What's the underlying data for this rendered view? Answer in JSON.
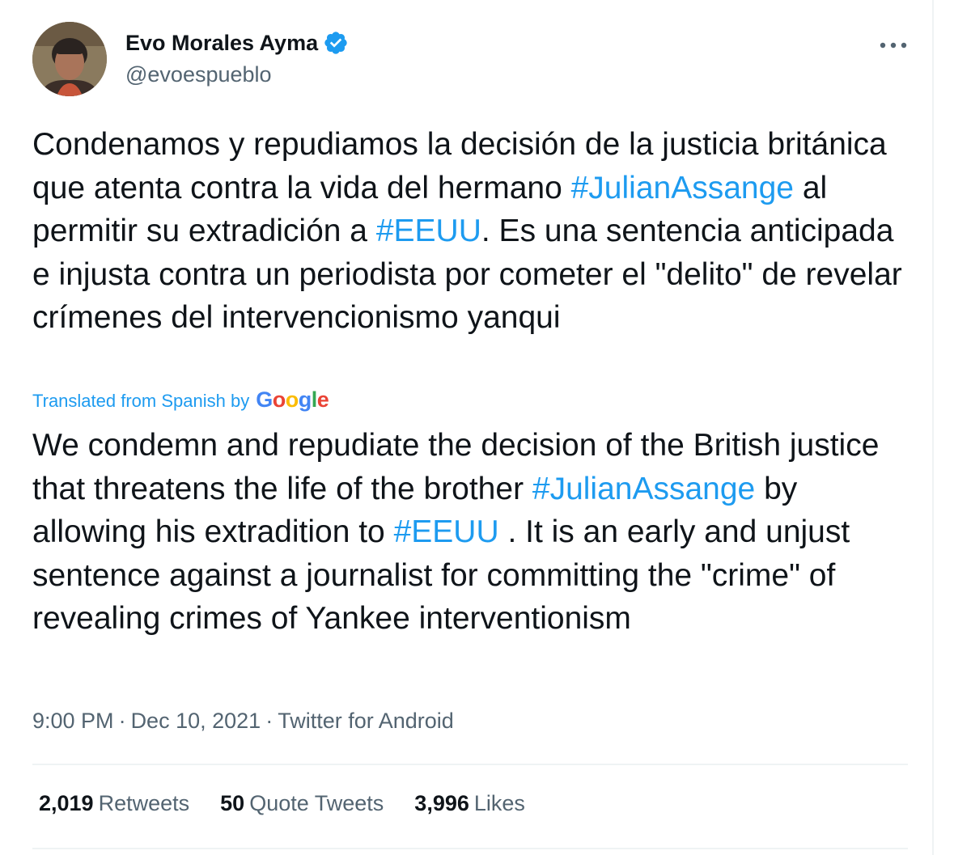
{
  "author": {
    "name": "Evo Morales Ayma",
    "handle": "@evoespueblo",
    "verified": true
  },
  "original_text": {
    "part1": "Condenamos y repudiamos la decisión de la justicia británica que atenta contra la vida del hermano ",
    "hashtag1": "#JulianAssange",
    "part2": " al permitir su extradición a ",
    "hashtag2": "#EEUU",
    "part3": ". Es una sentencia anticipada e injusta contra un periodista por cometer el \"delito\" de revelar crímenes del intervencionismo yanqui"
  },
  "translation": {
    "note": "Translated from Spanish by",
    "provider": "Google",
    "part1": "We condemn and repudiate the decision of the British justice that threatens the life of the brother ",
    "hashtag1": "#JulianAssange",
    "part2": " by allowing his extradition to ",
    "hashtag2": "#EEUU",
    "part3": " . It is an early and unjust sentence against a journalist for committing the \"crime\" of revealing crimes of Yankee interventionism"
  },
  "meta": {
    "time": "9:00 PM",
    "date": "Dec 10, 2021",
    "source": "Twitter for Android",
    "separator": "·"
  },
  "stats": {
    "retweets": {
      "count": "2,019",
      "label": "Retweets"
    },
    "quotes": {
      "count": "50",
      "label": "Quote Tweets"
    },
    "likes": {
      "count": "3,996",
      "label": "Likes"
    }
  },
  "colors": {
    "link": "#1d9bf0",
    "text": "#0f1419",
    "secondary": "#536471",
    "border": "#eff3f4"
  },
  "icons": {
    "verified": "verified-badge-icon",
    "more": "more-horizontal-icon"
  }
}
